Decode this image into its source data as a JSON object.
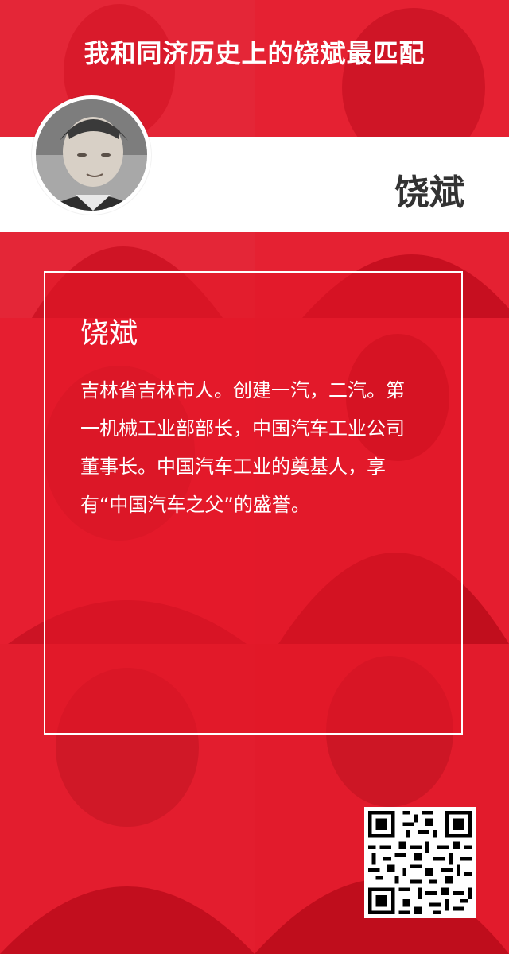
{
  "header": {
    "title": "我和同济历史上的饶斌最匹配"
  },
  "banner": {
    "name": "饶斌"
  },
  "avatar": {
    "alt": "饶斌 portrait"
  },
  "card": {
    "name": "饶斌",
    "description": "吉林省吉林市人。创建一汽，二汽。第一机械工业部部长，中国汽车工业公司董事长。中国汽车工业的奠基人，享有“中国汽车之父”的盛誉。"
  },
  "colors": {
    "background": "#e8202f",
    "banner": "#ffffff",
    "text_light": "#ffffff",
    "text_dark": "#333333"
  },
  "icons": {
    "qr": "qr-code-icon"
  }
}
